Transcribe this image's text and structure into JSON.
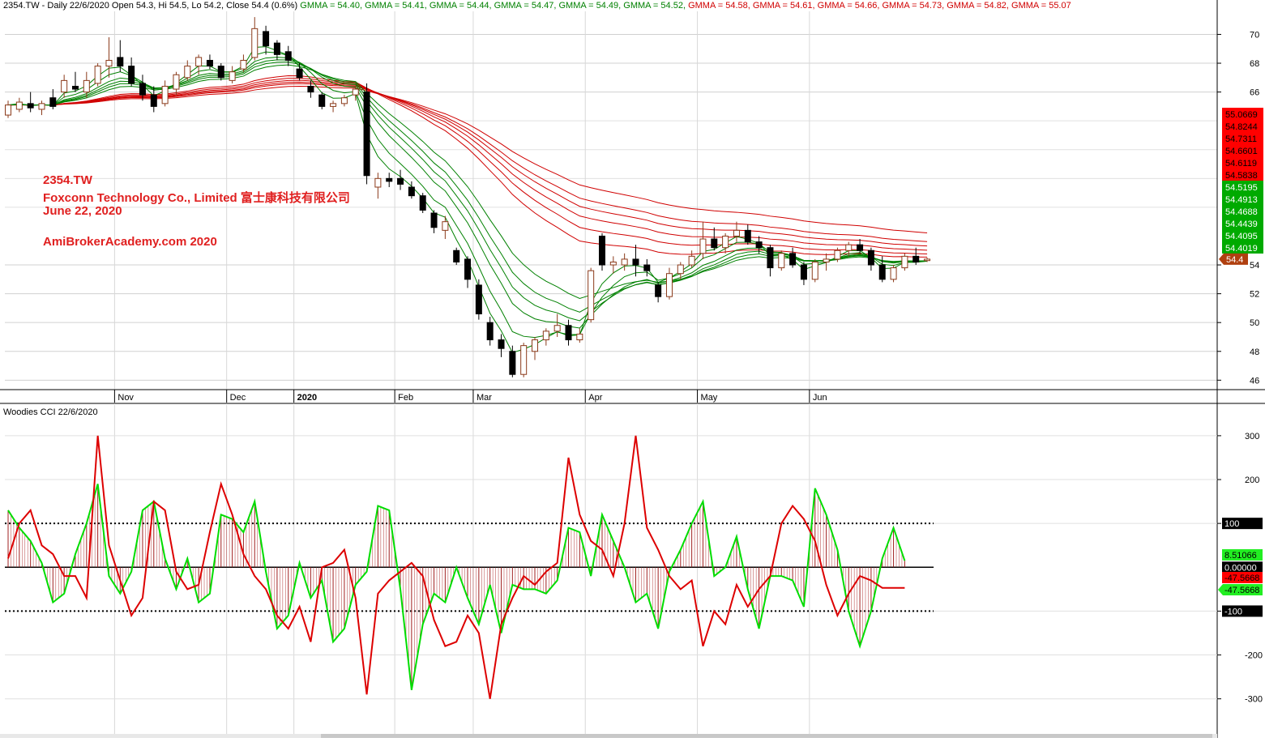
{
  "header": {
    "prefix": "2354.TW - Daily 22/6/2020 Open 54.3, Hi 54.5, Lo 54.2, Close 54.4 (0.6%)",
    "gmma": [
      {
        "label": "GMMA = 54.40,",
        "color": "#008000"
      },
      {
        "label": "GMMA = 54.41,",
        "color": "#008000"
      },
      {
        "label": "GMMA = 54.44,",
        "color": "#008000"
      },
      {
        "label": "GMMA = 54.47,",
        "color": "#008000"
      },
      {
        "label": "GMMA = 54.49,",
        "color": "#008000"
      },
      {
        "label": "GMMA = 54.52,",
        "color": "#008000"
      },
      {
        "label": "GMMA = 54.58,",
        "color": "#d00000"
      },
      {
        "label": "GMMA = 54.61,",
        "color": "#d00000"
      },
      {
        "label": "GMMA = 54.66,",
        "color": "#d00000"
      },
      {
        "label": "GMMA = 54.73,",
        "color": "#d00000"
      },
      {
        "label": "GMMA = 54.82,",
        "color": "#d00000"
      },
      {
        "label": "GMMA = 55.07",
        "color": "#d00000"
      }
    ]
  },
  "annotation": {
    "ticker": "2354.TW",
    "company": "Foxconn Technology Co., Limited  富士康科技有限公司",
    "date": "June 22, 2020",
    "site": "AmiBrokerAcademy.com  2020"
  },
  "cci_header": "Woodies CCI  22/6/2020",
  "colors": {
    "up_fill": "#ffffff",
    "up_stroke": "#8b3a1a",
    "down": "#000000",
    "short_ma": "#008000",
    "long_ma": "#d00000",
    "cci_fast": "#00dd00",
    "cci_slow": "#dd0000",
    "hist": "#a02020"
  },
  "chart_data": [
    {
      "type": "candlestick",
      "title": "2354.TW - Daily 22/6/2020",
      "y_axis": {
        "ticks": [
          46,
          48,
          50,
          52,
          54,
          66,
          68,
          70
        ],
        "range": [
          45.4,
          71.6
        ]
      },
      "x_labels": [
        "Nov",
        "Dec",
        "2020",
        "Feb",
        "Mar",
        "Apr",
        "May",
        "Jun"
      ],
      "month_start_bars": [
        10,
        20,
        26,
        35,
        42,
        52,
        62,
        72
      ],
      "last_price_label": "54.4",
      "gmma_value_labels": {
        "long": [
          "55.0669",
          "54.8244",
          "54.7311",
          "54.6601",
          "54.6119",
          "54.5838"
        ],
        "short": [
          "54.5195",
          "54.4913",
          "54.4688",
          "54.4439",
          "54.4095",
          "54.4019"
        ]
      },
      "ohlc": [
        [
          64.4,
          65.4,
          64.2,
          65.1
        ],
        [
          64.8,
          65.6,
          64.6,
          65.3
        ],
        [
          65.2,
          66.0,
          64.6,
          64.9
        ],
        [
          64.8,
          65.4,
          64.4,
          65.2
        ],
        [
          65.6,
          66.2,
          64.8,
          65.0
        ],
        [
          66.0,
          67.2,
          65.6,
          66.8
        ],
        [
          66.4,
          67.4,
          66.0,
          66.2
        ],
        [
          66.0,
          67.4,
          65.6,
          66.8
        ],
        [
          66.6,
          68.0,
          66.4,
          67.8
        ],
        [
          67.8,
          69.8,
          67.0,
          68.2
        ],
        [
          68.4,
          69.6,
          67.4,
          67.8
        ],
        [
          67.8,
          68.4,
          66.4,
          66.6
        ],
        [
          66.6,
          67.2,
          65.4,
          65.8
        ],
        [
          65.8,
          66.4,
          64.6,
          65.0
        ],
        [
          65.2,
          66.8,
          65.0,
          66.4
        ],
        [
          66.2,
          67.4,
          65.8,
          67.2
        ],
        [
          67.0,
          68.2,
          66.8,
          67.8
        ],
        [
          67.8,
          68.6,
          67.2,
          68.4
        ],
        [
          68.2,
          68.6,
          67.6,
          67.8
        ],
        [
          67.8,
          68.0,
          66.8,
          67.0
        ],
        [
          66.8,
          67.8,
          66.6,
          67.4
        ],
        [
          67.6,
          68.6,
          67.4,
          68.2
        ],
        [
          68.4,
          71.2,
          68.2,
          70.4
        ],
        [
          70.2,
          70.6,
          68.6,
          69.2
        ],
        [
          69.4,
          69.6,
          68.2,
          68.6
        ],
        [
          68.8,
          69.2,
          67.8,
          68.2
        ],
        [
          67.6,
          68.0,
          66.8,
          67.0
        ],
        [
          66.4,
          66.8,
          65.6,
          66.0
        ],
        [
          65.8,
          66.0,
          64.8,
          65.0
        ],
        [
          65.0,
          65.4,
          64.6,
          65.2
        ],
        [
          65.2,
          65.8,
          65.0,
          65.6
        ],
        [
          65.8,
          66.4,
          65.4,
          66.2
        ],
        [
          66.0,
          66.6,
          59.6,
          60.2
        ],
        [
          59.4,
          60.4,
          58.6,
          60.0
        ],
        [
          60.0,
          60.4,
          59.4,
          59.8
        ],
        [
          60.0,
          60.6,
          59.2,
          59.6
        ],
        [
          59.4,
          59.8,
          58.6,
          58.8
        ],
        [
          58.8,
          59.0,
          57.6,
          57.8
        ],
        [
          57.6,
          57.8,
          56.2,
          56.6
        ],
        [
          56.4,
          57.4,
          55.8,
          57.0
        ],
        [
          55.0,
          55.2,
          54.0,
          54.2
        ],
        [
          54.4,
          54.6,
          52.4,
          53.0
        ],
        [
          52.6,
          53.0,
          50.2,
          50.6
        ],
        [
          50.0,
          50.4,
          48.4,
          48.8
        ],
        [
          48.8,
          49.2,
          47.6,
          48.2
        ],
        [
          48.0,
          48.4,
          46.2,
          46.4
        ],
        [
          46.4,
          48.6,
          46.2,
          48.4
        ],
        [
          48.0,
          49.0,
          47.4,
          48.8
        ],
        [
          48.8,
          49.6,
          48.4,
          49.4
        ],
        [
          49.4,
          50.6,
          49.0,
          49.8
        ],
        [
          49.8,
          50.2,
          48.4,
          48.8
        ],
        [
          48.8,
          49.6,
          48.6,
          49.2
        ],
        [
          50.2,
          53.8,
          50.0,
          53.6
        ],
        [
          56.0,
          56.2,
          53.6,
          54.0
        ],
        [
          54.0,
          54.6,
          53.4,
          54.2
        ],
        [
          54.0,
          54.8,
          53.6,
          54.4
        ],
        [
          54.4,
          55.4,
          53.2,
          54.0
        ],
        [
          54.0,
          54.4,
          53.2,
          53.6
        ],
        [
          52.6,
          52.8,
          51.4,
          51.8
        ],
        [
          51.8,
          53.8,
          51.6,
          53.4
        ],
        [
          53.4,
          54.2,
          53.0,
          54.0
        ],
        [
          54.0,
          55.0,
          53.8,
          54.6
        ],
        [
          54.8,
          57.0,
          54.4,
          55.8
        ],
        [
          55.8,
          56.6,
          55.0,
          55.2
        ],
        [
          55.2,
          56.2,
          54.8,
          56.0
        ],
        [
          56.0,
          57.0,
          55.6,
          56.4
        ],
        [
          56.4,
          56.8,
          55.4,
          55.6
        ],
        [
          55.6,
          56.0,
          54.8,
          55.2
        ],
        [
          55.2,
          55.4,
          53.2,
          53.8
        ],
        [
          53.8,
          55.0,
          53.6,
          54.8
        ],
        [
          54.8,
          55.2,
          53.8,
          54.0
        ],
        [
          54.0,
          54.2,
          52.6,
          53.0
        ],
        [
          53.0,
          54.4,
          52.8,
          54.2
        ],
        [
          54.2,
          54.8,
          53.6,
          54.4
        ],
        [
          54.4,
          55.2,
          54.2,
          55.0
        ],
        [
          55.0,
          55.6,
          54.6,
          55.4
        ],
        [
          55.4,
          55.8,
          54.8,
          55.0
        ],
        [
          55.0,
          55.2,
          53.6,
          54.0
        ],
        [
          54.0,
          54.6,
          52.8,
          53.0
        ],
        [
          53.0,
          54.0,
          52.8,
          53.8
        ],
        [
          53.8,
          54.8,
          53.6,
          54.6
        ],
        [
          54.6,
          55.2,
          54.0,
          54.2
        ],
        [
          54.3,
          54.5,
          54.2,
          54.4
        ]
      ]
    },
    {
      "type": "line",
      "title": "Woodies CCI  22/6/2020",
      "y_axis": {
        "ticks": [
          -300,
          -200,
          -100,
          100,
          200,
          300
        ],
        "range": [
          -380,
          370
        ]
      },
      "reference_lines": [
        100,
        0,
        -100
      ],
      "value_labels": [
        "100",
        "8.51066",
        "0.00000",
        "-47.5668",
        "-47.5668",
        "-100"
      ],
      "series": [
        {
          "name": "",
          "color": "#00dd00",
          "values": [
            130,
            90,
            60,
            10,
            -80,
            -60,
            30,
            100,
            190,
            -20,
            -60,
            -10,
            130,
            150,
            20,
            -50,
            20,
            -80,
            -60,
            120,
            110,
            80,
            150,
            -10,
            -140,
            -110,
            10,
            -70,
            -30,
            -170,
            -140,
            -40,
            -10,
            140,
            130,
            -50,
            -280,
            -130,
            -60,
            -80,
            0,
            -70,
            -130,
            -40,
            -150,
            -40,
            -50,
            -50,
            -60,
            -30,
            90,
            80,
            -20,
            120,
            60,
            0,
            -80,
            -60,
            -140,
            -10,
            40,
            100,
            150,
            -20,
            0,
            70,
            -50,
            -140,
            -20,
            -20,
            -30,
            -90,
            180,
            120,
            40,
            -100,
            -180,
            -100,
            20,
            90,
            15
          ]
        },
        {
          "name": "",
          "color": "#dd0000",
          "values": [
            20,
            100,
            130,
            50,
            30,
            -20,
            -20,
            -70,
            300,
            50,
            -30,
            -110,
            -70,
            150,
            130,
            -10,
            -50,
            -40,
            80,
            190,
            120,
            30,
            -20,
            -50,
            -110,
            -140,
            -90,
            -170,
            0,
            10,
            40,
            -70,
            -290,
            -60,
            -30,
            -10,
            10,
            -20,
            -120,
            -180,
            -170,
            -110,
            -150,
            -300,
            -130,
            -70,
            -20,
            -40,
            -10,
            10,
            250,
            120,
            60,
            40,
            -20,
            100,
            300,
            90,
            40,
            -20,
            -50,
            -30,
            -180,
            -100,
            -130,
            -40,
            -90,
            -50,
            -20,
            100,
            140,
            110,
            60,
            -40,
            -110,
            -60,
            -20,
            -30,
            -47,
            -47,
            -47
          ]
        }
      ]
    }
  ]
}
